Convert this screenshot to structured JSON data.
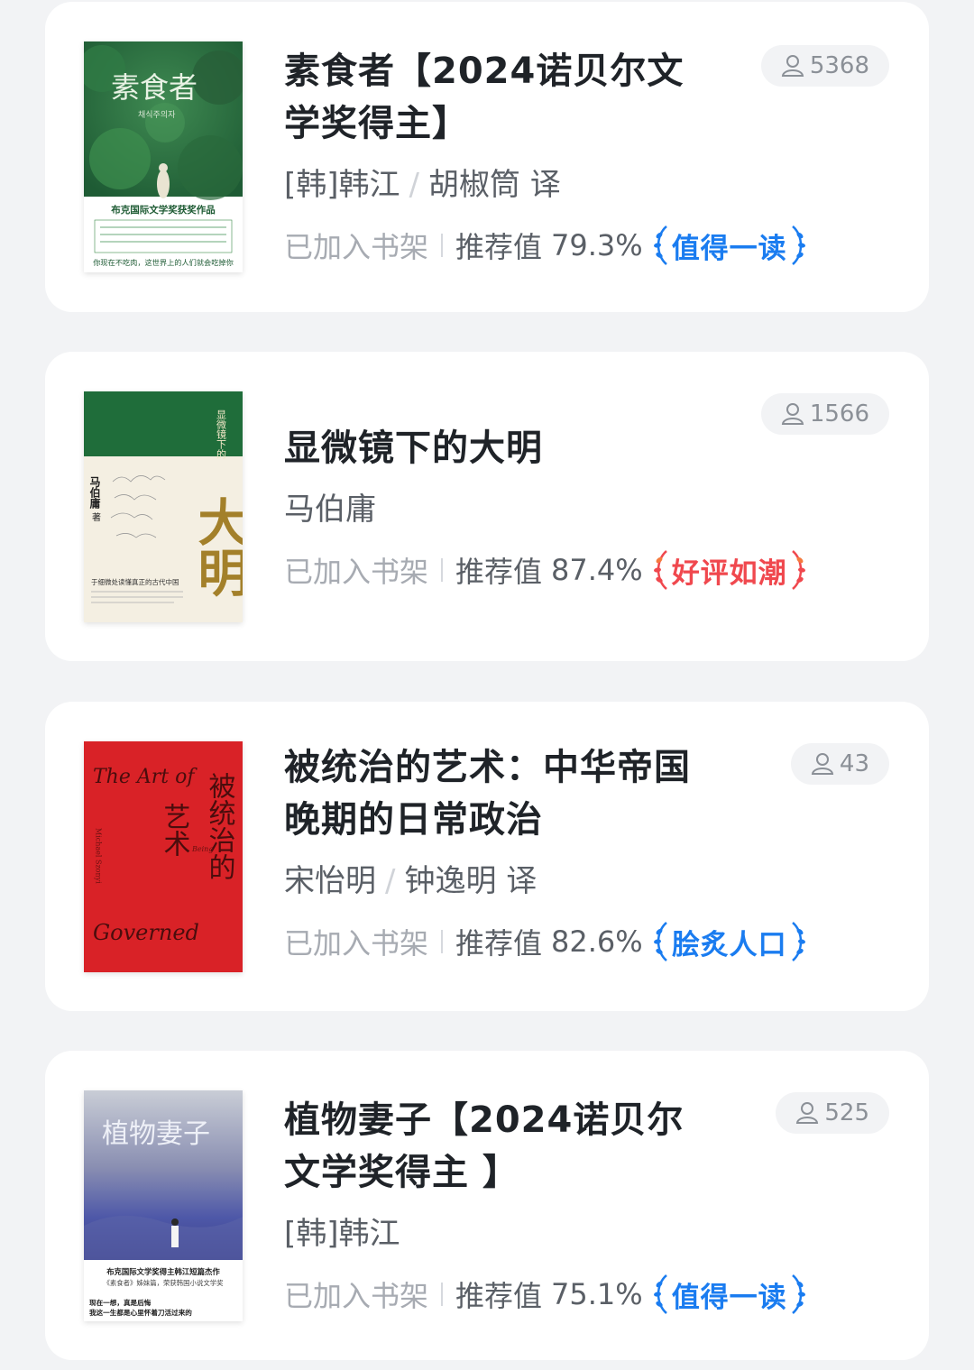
{
  "colors": {
    "badge_blue": "#1a7cf0",
    "badge_red": "#f0484e"
  },
  "books": [
    {
      "title": "素食者【2024诺贝尔文学奖得主】",
      "author": "[韩]韩江",
      "translator": "胡椒筒 译",
      "shelf_label": "已加入书架",
      "rec_label": "推荐值",
      "rec_value": "79.3%",
      "badge": "值得一读",
      "badge_color": "blue",
      "readers": "5368",
      "cover": {
        "title": "素食者",
        "subtitle": "채식주의자",
        "band": "布克国际文学奖获奖作品",
        "tagline": "你现在不吃肉，这世界上的人们就会吃掉你"
      }
    },
    {
      "title": "显微镜下的大明",
      "author": "马伯庸",
      "translator": "",
      "shelf_label": "已加入书架",
      "rec_label": "推荐值",
      "rec_value": "87.4%",
      "badge": "好评如潮",
      "badge_color": "red",
      "readers": "1566",
      "cover": {
        "vertical_title": "显微镜下的",
        "big_title": "大明",
        "author": "马伯庸",
        "author_suffix": "著",
        "blurb": "于细微处读懂真正的古代中国"
      }
    },
    {
      "title": "被统治的艺术：中华帝国晚期的日常政治",
      "author": "宋怡明",
      "translator": "钟逸明 译",
      "shelf_label": "已加入书架",
      "rec_label": "推荐值",
      "rec_value": "82.6%",
      "badge": "脍炙人口",
      "badge_color": "blue",
      "readers": "43",
      "cover": {
        "en_top": "The Art of",
        "en_mid": "Being",
        "en_bottom": "Governed",
        "zh_1": "被统治的",
        "zh_2": "艺术",
        "author_en": "Michael Szonyi"
      }
    },
    {
      "title": "植物妻子【2024诺贝尔文学奖得主 】",
      "author": "[韩]韩江",
      "translator": "",
      "shelf_label": "已加入书架",
      "rec_label": "推荐值",
      "rec_value": "75.1%",
      "badge": "值得一读",
      "badge_color": "blue",
      "readers": "525",
      "cover": {
        "title": "植物妻子",
        "band_1": "布克国际文学奖得主韩江短篇杰作",
        "band_2": "《素食者》姊妹篇，荣获韩国小说文学奖",
        "tagline_1": "现在一想，真是后悔",
        "tagline_2": "我这一生都是心里怀着刀活过来的"
      }
    }
  ]
}
